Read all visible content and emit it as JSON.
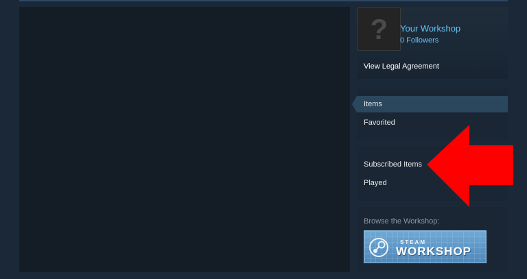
{
  "profile": {
    "avatar_glyph": "?",
    "workshop_title": "Your Workshop",
    "followers": "0 Followers",
    "legal_link": "View Legal Agreement"
  },
  "nav_primary": {
    "items": [
      {
        "label": "Items",
        "active": true
      },
      {
        "label": "Favorited",
        "active": false
      }
    ]
  },
  "nav_secondary": {
    "items": [
      {
        "label": "Subscribed Items"
      },
      {
        "label": "Played"
      }
    ]
  },
  "browse": {
    "label": "Browse the Workshop:",
    "button_small_text": "STEAM",
    "button_large_text": "WORKSHOP"
  },
  "colors": {
    "background": "#1b2838",
    "link_blue": "#66c0f4",
    "active_nav": "#2a475e",
    "arrow_red": "#ff0000"
  },
  "icons": {
    "avatar": "question-mark-avatar",
    "steam_logo": "steam-logo-icon",
    "annotation": "red-arrow-icon"
  }
}
